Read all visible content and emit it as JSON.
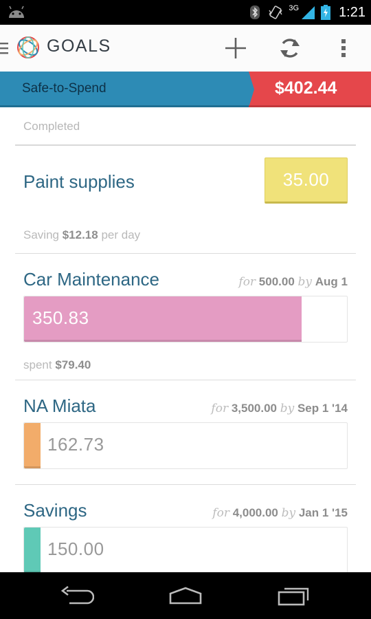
{
  "status_bar": {
    "network_label": "3G",
    "time": "1:21"
  },
  "action_bar": {
    "title": "GOALS",
    "actions": [
      "add",
      "sync",
      "overflow"
    ]
  },
  "banner": {
    "label": "Safe-to-Spend",
    "amount": "$402.44",
    "colors": {
      "left": "#2d8bb5",
      "right": "#e5474b"
    }
  },
  "completed_section": {
    "header": "Completed",
    "goal": {
      "name": "Paint supplies",
      "amount": "35.00",
      "saving_prefix": "Saving",
      "saving_value": "$12.18",
      "saving_suffix": "per day",
      "color": "#f0e27a"
    }
  },
  "goals": [
    {
      "name": "Car Maintenance",
      "for_label": "for",
      "target": "500.00",
      "by_label": "by",
      "due": "Aug 1",
      "current": "350.83",
      "progress": 0.86,
      "color": "#e49cc3",
      "spent_label": "spent",
      "spent_value": "$79.40"
    },
    {
      "name": "NA Miata",
      "for_label": "for",
      "target": "3,500.00",
      "by_label": "by",
      "due": "Sep 1 '14",
      "current": "162.73",
      "progress": 0.05,
      "color": "#f2ac6a"
    },
    {
      "name": "Savings",
      "for_label": "for",
      "target": "4,000.00",
      "by_label": "by",
      "due": "Jan 1 '15",
      "current": "150.00",
      "progress": 0.05,
      "color": "#5fc9b6"
    }
  ]
}
